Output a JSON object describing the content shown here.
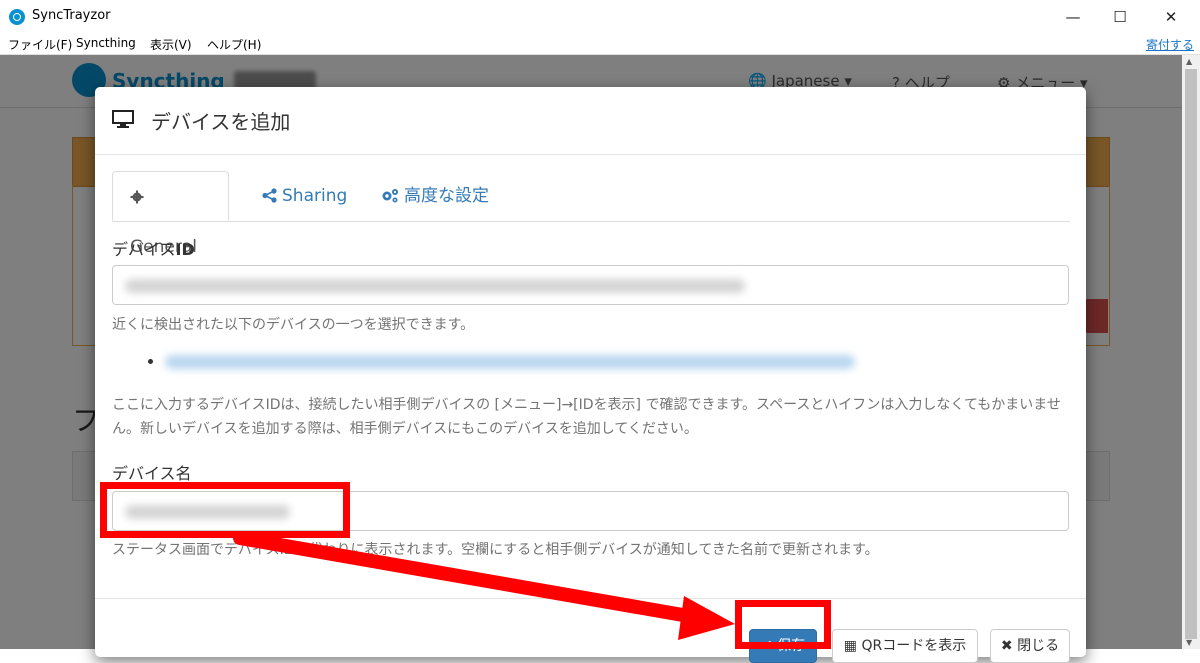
{
  "window": {
    "title": "SyncTrayzor",
    "minimize_glyph": "—",
    "maximize_glyph": "☐",
    "close_glyph": "✕"
  },
  "menubar": {
    "items": [
      "ファイル(F)",
      "Syncthing",
      "表示(V)",
      "ヘルプ(H)"
    ],
    "donate": "寄付する"
  },
  "background": {
    "logo": "Syncthing",
    "language": "Japanese",
    "help": "ヘルプ",
    "menu": "メニュー",
    "heading_char": "フ"
  },
  "modal": {
    "title": "デバイスを追加",
    "tabs": [
      {
        "label": "General",
        "icon": "gear-icon",
        "active": true
      },
      {
        "label": "Sharing",
        "icon": "share-icon",
        "active": false
      },
      {
        "label": "高度な設定",
        "icon": "cogs-icon",
        "active": false
      }
    ],
    "device_id": {
      "label_prefix": "デバイス",
      "label_suffix": "ID",
      "value": "",
      "help_nearby": "近くに検出された以下のデバイスの一つを選択できます。",
      "help_text": "ここに入力するデバイスIDは、接続したい相手側デバイスの [メニュー]→[IDを表示] で確認できます。スペースとハイフンは入力しなくてもかまいません。新しいデバイスを追加する際は、相手側デバイスにもこのデバイスを追加してください。"
    },
    "device_name": {
      "label": "デバイス名",
      "value": "",
      "help_text": "ステータス画面でデバイスIDの代わりに表示されます。空欄にすると相手側デバイスが通知してきた名前で更新されます。"
    },
    "footer": {
      "save": "保存",
      "qr": "QRコードを表示",
      "close": "閉じる"
    }
  },
  "colors": {
    "accent": "#337ab7",
    "brand": "#0891d1",
    "annotation": "#ff0000",
    "warning": "#f0ad4e"
  }
}
